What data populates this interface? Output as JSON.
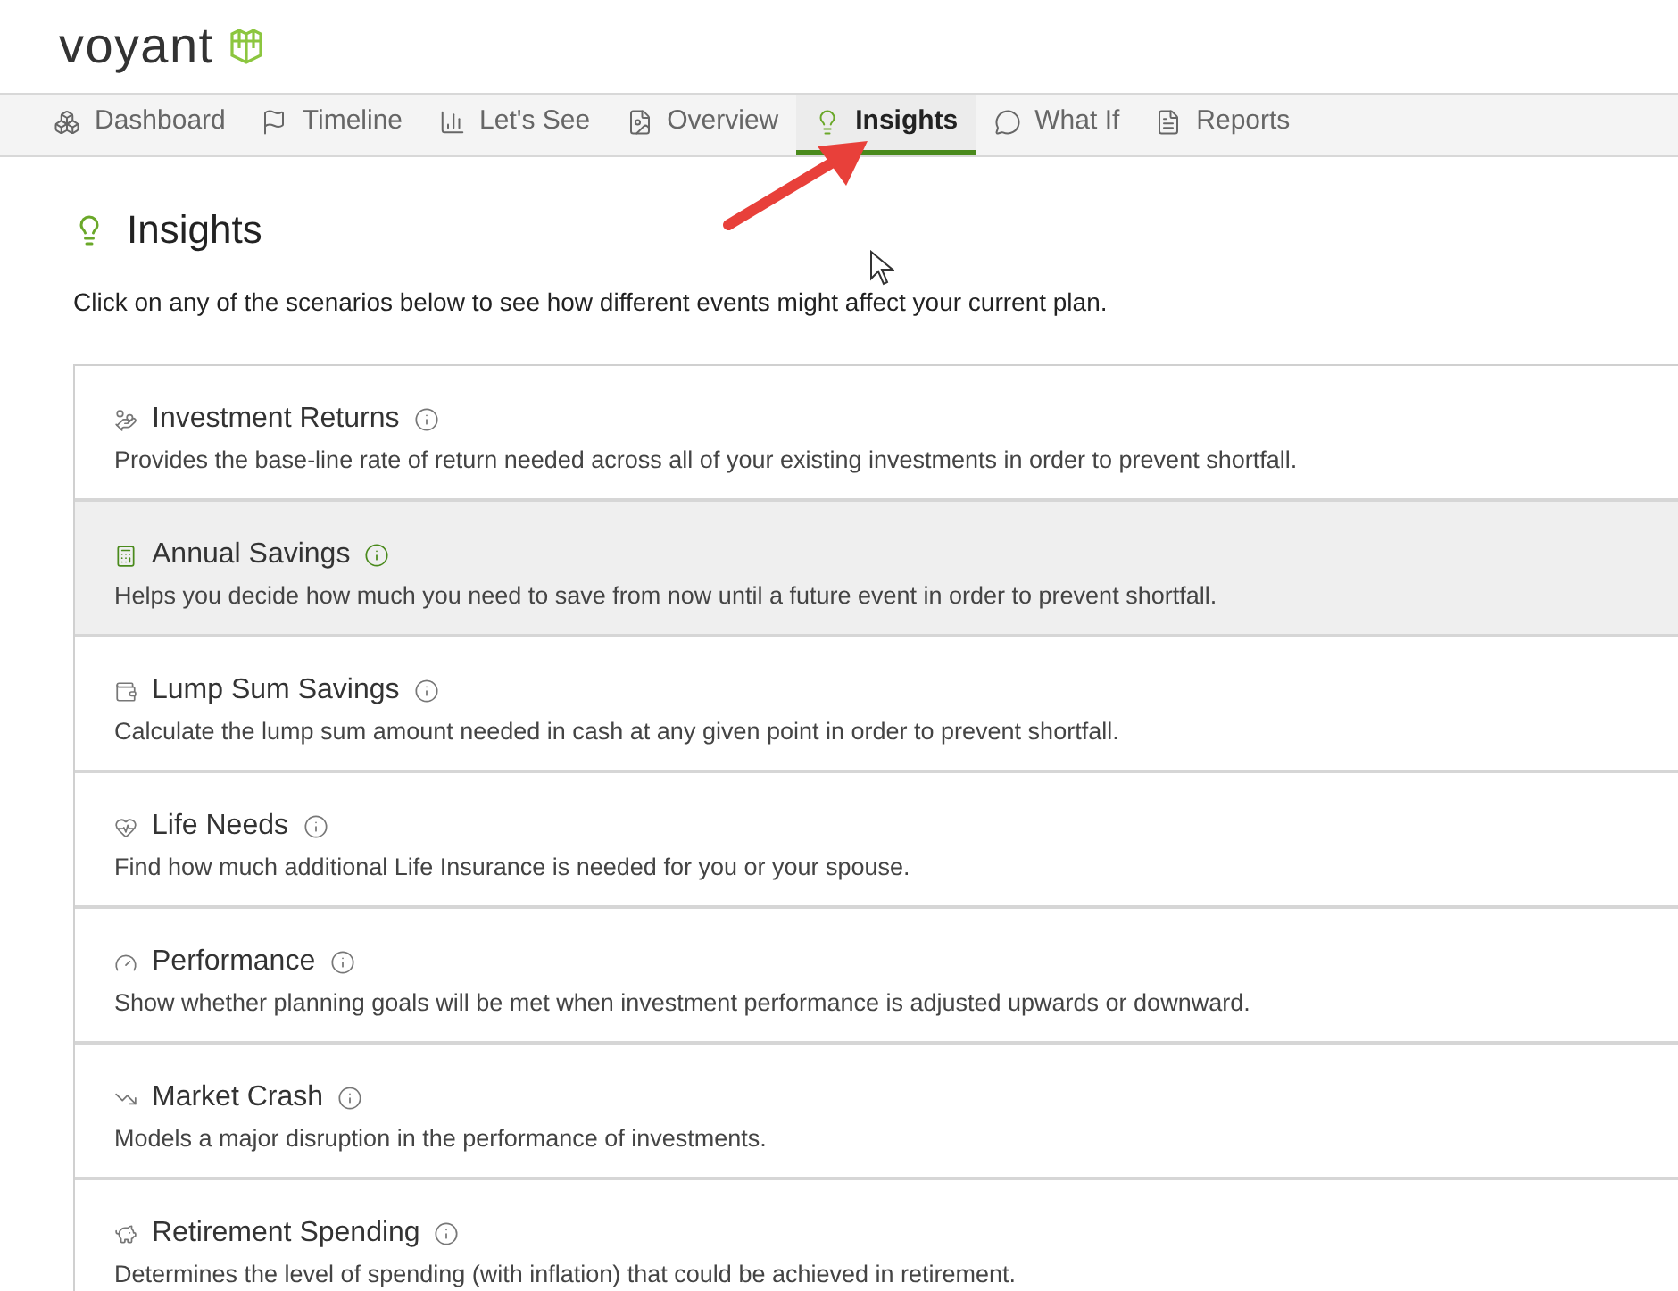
{
  "brand": {
    "name": "voyant"
  },
  "tabs": [
    {
      "label": "Dashboard",
      "selected": false
    },
    {
      "label": "Timeline",
      "selected": false
    },
    {
      "label": "Let's See",
      "selected": false
    },
    {
      "label": "Overview",
      "selected": false
    },
    {
      "label": "Insights",
      "selected": true
    },
    {
      "label": "What If",
      "selected": false
    },
    {
      "label": "Reports",
      "selected": false
    }
  ],
  "page": {
    "title": "Insights",
    "intro": "Click on any of the scenarios below to see how different events might affect your current plan."
  },
  "scenarios": [
    {
      "title": "Investment Returns",
      "selected": false,
      "description": "Provides the base-line rate of return needed across all of your existing investments in order to prevent shortfall."
    },
    {
      "title": "Annual Savings",
      "selected": true,
      "description": "Helps you decide how much you need to save from now until a future event in order to prevent shortfall."
    },
    {
      "title": "Lump Sum Savings",
      "selected": false,
      "description": "Calculate the lump sum amount needed in cash at any given point in order to prevent shortfall."
    },
    {
      "title": "Life Needs",
      "selected": false,
      "description": "Find how much additional Life Insurance is needed for you or your spouse."
    },
    {
      "title": "Performance",
      "selected": false,
      "description": "Show whether planning goals will be met when investment performance is adjusted upwards or downward."
    },
    {
      "title": "Market Crash",
      "selected": false,
      "description": "Models a major disruption in the performance of investments."
    },
    {
      "title": "Retirement Spending",
      "selected": false,
      "description": "Determines the level of spending (with inflation) that could be achieved in retirement."
    }
  ]
}
